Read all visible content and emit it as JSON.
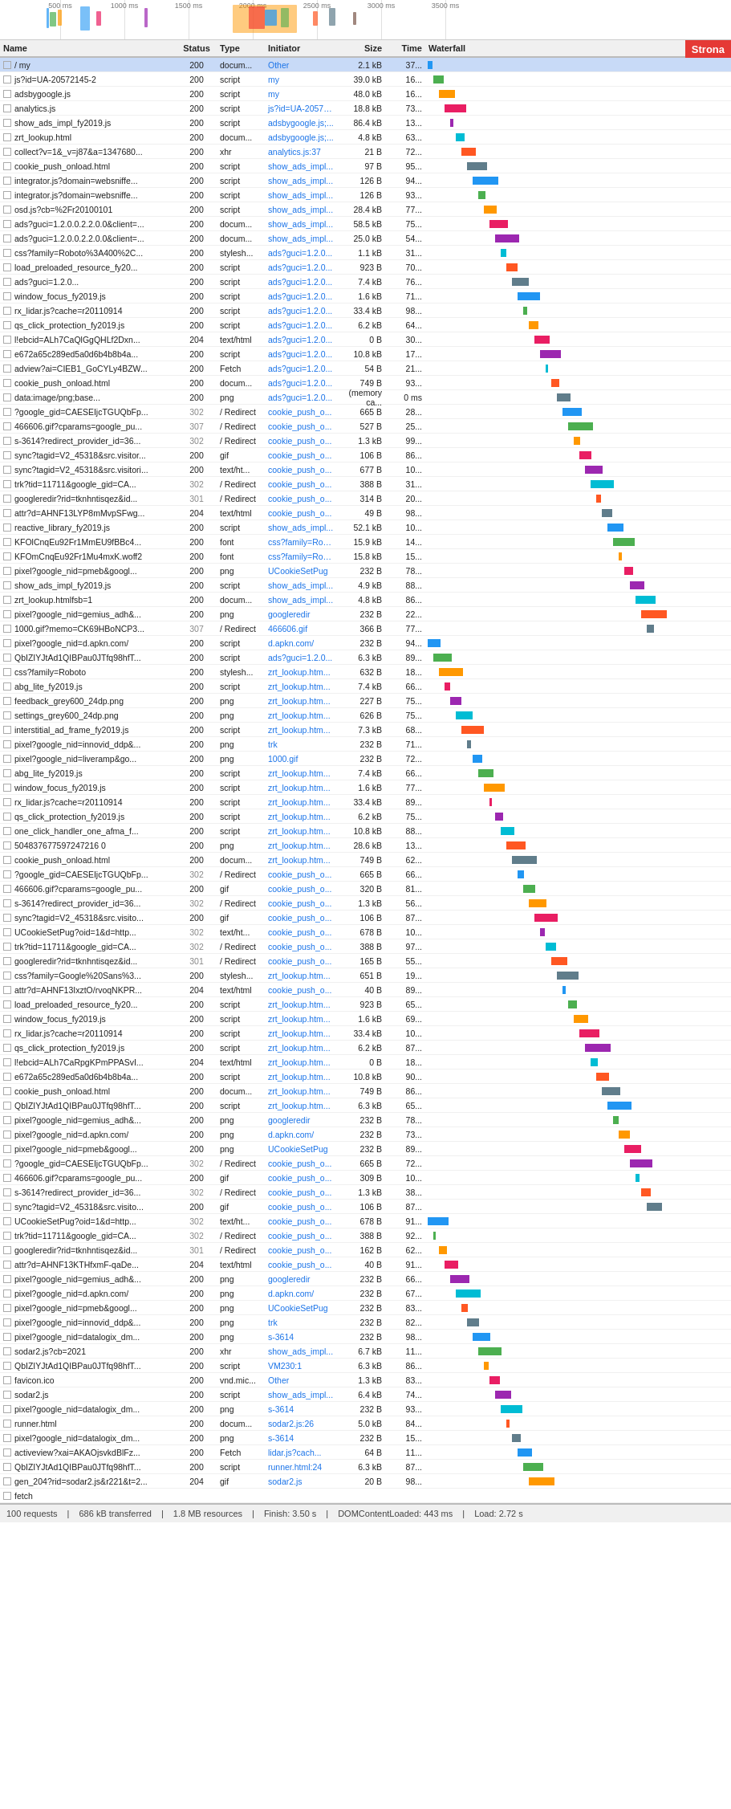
{
  "header": {
    "columns": [
      "Name",
      "Status",
      "Type",
      "Initiator",
      "Size",
      "Time",
      "Waterfall"
    ],
    "strona_badge": "Strona"
  },
  "timeline": {
    "ticks": [
      "500 ms",
      "1000 ms",
      "1500 ms",
      "2000 ms",
      "2500 ms",
      "3000 ms",
      "3500 ms"
    ]
  },
  "rows": [
    {
      "name": "/ my",
      "status": "200",
      "type": "docum...",
      "initiator": "Other",
      "size": "2.1 kB",
      "time": "37...",
      "selected": true
    },
    {
      "name": "js?id=UA-20572145-2",
      "status": "200",
      "type": "script",
      "initiator": "my",
      "size": "39.0 kB",
      "time": "16..."
    },
    {
      "name": "adsbygoogle.js",
      "status": "200",
      "type": "script",
      "initiator": "my",
      "size": "48.0 kB",
      "time": "16..."
    },
    {
      "name": "analytics.js",
      "status": "200",
      "type": "script",
      "initiator": "js?id=UA-20572...",
      "size": "18.8 kB",
      "time": "73..."
    },
    {
      "name": "show_ads_impl_fy2019.js",
      "status": "200",
      "type": "script",
      "initiator": "adsbygoogle.js;...",
      "size": "86.4 kB",
      "time": "13..."
    },
    {
      "name": "zrt_lookup.html",
      "status": "200",
      "type": "docum...",
      "initiator": "adsbygoogle.js;...",
      "size": "4.8 kB",
      "time": "63..."
    },
    {
      "name": "collect?v=1&_v=j87&a=1347680...",
      "status": "200",
      "type": "xhr",
      "initiator": "analytics.js:37",
      "size": "21 B",
      "time": "72..."
    },
    {
      "name": "cookie_push_onload.html",
      "status": "200",
      "type": "script",
      "initiator": "show_ads_impl...",
      "size": "97 B",
      "time": "95..."
    },
    {
      "name": "integrator.js?domain=websniffe...",
      "status": "200",
      "type": "script",
      "initiator": "show_ads_impl...",
      "size": "126 B",
      "time": "94..."
    },
    {
      "name": "integrator.js?domain=websniffe...",
      "status": "200",
      "type": "script",
      "initiator": "show_ads_impl...",
      "size": "126 B",
      "time": "93..."
    },
    {
      "name": "osd.js?cb=%2Fr20100101",
      "status": "200",
      "type": "script",
      "initiator": "show_ads_impl...",
      "size": "28.4 kB",
      "time": "77..."
    },
    {
      "name": "ads?guci=1.2.0.0.2.2.0.0&client=...",
      "status": "200",
      "type": "docum...",
      "initiator": "show_ads_impl...",
      "size": "58.5 kB",
      "time": "75..."
    },
    {
      "name": "ads?guci=1.2.0.0.2.2.0.0&client=...",
      "status": "200",
      "type": "docum...",
      "initiator": "show_ads_impl...",
      "size": "25.0 kB",
      "time": "54..."
    },
    {
      "name": "css?family=Roboto%3A400%2C...",
      "status": "200",
      "type": "stylesh...",
      "initiator": "ads?guci=1.2.0...",
      "size": "1.1 kB",
      "time": "31..."
    },
    {
      "name": "load_preloaded_resource_fy20...",
      "status": "200",
      "type": "script",
      "initiator": "ads?guci=1.2.0...",
      "size": "923 B",
      "time": "70..."
    },
    {
      "name": "ads?guci=1.2.0...",
      "status": "200",
      "type": "script",
      "initiator": "ads?guci=1.2.0...",
      "size": "7.4 kB",
      "time": "76..."
    },
    {
      "name": "window_focus_fy2019.js",
      "status": "200",
      "type": "script",
      "initiator": "ads?guci=1.2.0...",
      "size": "1.6 kB",
      "time": "71..."
    },
    {
      "name": "rx_lidar.js?cache=r20110914",
      "status": "200",
      "type": "script",
      "initiator": "ads?guci=1.2.0...",
      "size": "33.4 kB",
      "time": "98..."
    },
    {
      "name": "qs_click_protection_fy2019.js",
      "status": "200",
      "type": "script",
      "initiator": "ads?guci=1.2.0...",
      "size": "6.2 kB",
      "time": "64..."
    },
    {
      "name": "l!ebcid=ALh7CaQlGgQHLf2Dxn...",
      "status": "204",
      "type": "text/html",
      "initiator": "ads?guci=1.2.0...",
      "size": "0 B",
      "time": "30..."
    },
    {
      "name": "e672a65c289ed5a0d6b4b8b4a...",
      "status": "200",
      "type": "script",
      "initiator": "ads?guci=1.2.0...",
      "size": "10.8 kB",
      "time": "17..."
    },
    {
      "name": "adview?ai=CIEB1_GoCYLy4BZW...",
      "status": "200",
      "type": "Fetch",
      "initiator": "ads?guci=1.2.0...",
      "size": "54 B",
      "time": "21..."
    },
    {
      "name": "cookie_push_onload.html",
      "status": "200",
      "type": "docum...",
      "initiator": "ads?guci=1.2.0...",
      "size": "749 B",
      "time": "93..."
    },
    {
      "name": "data:image/png;base...",
      "status": "200",
      "type": "png",
      "initiator": "ads?guci=1.2.0...",
      "size": "(memory ca...",
      "time": "0 ms"
    },
    {
      "name": "?google_gid=CAESEIjcTGUQbFp...",
      "status": "302",
      "type": "/ Redirect",
      "initiator": "cookie_push_o...",
      "size": "665 B",
      "time": "28..."
    },
    {
      "name": "466606.gif?cparams=google_pu...",
      "status": "307",
      "type": "/ Redirect",
      "initiator": "cookie_push_o...",
      "size": "527 B",
      "time": "25..."
    },
    {
      "name": "s-3614?redirect_provider_id=36...",
      "status": "302",
      "type": "/ Redirect",
      "initiator": "cookie_push_o...",
      "size": "1.3 kB",
      "time": "99..."
    },
    {
      "name": "sync?tagid=V2_45318&src.visitor...",
      "status": "200",
      "type": "gif",
      "initiator": "cookie_push_o...",
      "size": "106 B",
      "time": "86..."
    },
    {
      "name": "sync?tagid=V2_45318&src.visitori...",
      "status": "200",
      "type": "text/ht...",
      "initiator": "cookie_push_o...",
      "size": "677 B",
      "time": "10..."
    },
    {
      "name": "trk?tid=11711&google_gid=CA...",
      "status": "302",
      "type": "/ Redirect",
      "initiator": "cookie_push_o...",
      "size": "388 B",
      "time": "31..."
    },
    {
      "name": "googleredir?rid=tknhntisqez&id...",
      "status": "301",
      "type": "/ Redirect",
      "initiator": "cookie_push_o...",
      "size": "314 B",
      "time": "20..."
    },
    {
      "name": "attr?d=AHNF13LYP8mMvpSFwg...",
      "status": "204",
      "type": "text/html",
      "initiator": "cookie_push_o...",
      "size": "49 B",
      "time": "98..."
    },
    {
      "name": "reactive_library_fy2019.js",
      "status": "200",
      "type": "script",
      "initiator": "show_ads_impl...",
      "size": "52.1 kB",
      "time": "10..."
    },
    {
      "name": "KFOlCnqEu92Fr1MmEU9fBBc4...",
      "status": "200",
      "type": "font",
      "initiator": "css?family=Rob...",
      "size": "15.9 kB",
      "time": "14..."
    },
    {
      "name": "KFOmCnqEu92Fr1Mu4mxK.woff2",
      "status": "200",
      "type": "font",
      "initiator": "css?family=Rob...",
      "size": "15.8 kB",
      "time": "15..."
    },
    {
      "name": "pixel?google_nid=pmeb&googl...",
      "status": "200",
      "type": "png",
      "initiator": "UCookieSetPug",
      "size": "232 B",
      "time": "78..."
    },
    {
      "name": "show_ads_impl_fy2019.js",
      "status": "200",
      "type": "script",
      "initiator": "show_ads_impl...",
      "size": "4.9 kB",
      "time": "88..."
    },
    {
      "name": "zrt_lookup.htmlfsb=1",
      "status": "200",
      "type": "docum...",
      "initiator": "show_ads_impl...",
      "size": "4.8 kB",
      "time": "86..."
    },
    {
      "name": "pixel?google_nid=gemius_adh&...",
      "status": "200",
      "type": "png",
      "initiator": "googleredir",
      "size": "232 B",
      "time": "22..."
    },
    {
      "name": "1000.gif?memo=CK69HBoNCP3...",
      "status": "307",
      "type": "/ Redirect",
      "initiator": "466606.gif",
      "size": "366 B",
      "time": "77..."
    },
    {
      "name": "pixel?google_nid=d.apkn.com/",
      "status": "200",
      "type": "script",
      "initiator": "d.apkn.com/",
      "size": "232 B",
      "time": "94..."
    },
    {
      "name": "QbIZIYJtAd1QIBPau0JTfq98hfT...",
      "status": "200",
      "type": "script",
      "initiator": "ads?guci=1.2.0...",
      "size": "6.3 kB",
      "time": "89..."
    },
    {
      "name": "css?family=Roboto",
      "status": "200",
      "type": "stylesh...",
      "initiator": "zrt_lookup.htm...",
      "size": "632 B",
      "time": "18..."
    },
    {
      "name": "abg_lite_fy2019.js",
      "status": "200",
      "type": "script",
      "initiator": "zrt_lookup.htm...",
      "size": "7.4 kB",
      "time": "66..."
    },
    {
      "name": "feedback_grey600_24dp.png",
      "status": "200",
      "type": "png",
      "initiator": "zrt_lookup.htm...",
      "size": "227 B",
      "time": "75..."
    },
    {
      "name": "settings_grey600_24dp.png",
      "status": "200",
      "type": "png",
      "initiator": "zrt_lookup.htm...",
      "size": "626 B",
      "time": "75..."
    },
    {
      "name": "interstitial_ad_frame_fy2019.js",
      "status": "200",
      "type": "script",
      "initiator": "zrt_lookup.htm...",
      "size": "7.3 kB",
      "time": "68..."
    },
    {
      "name": "pixel?google_nid=innovid_ddp&...",
      "status": "200",
      "type": "png",
      "initiator": "trk",
      "size": "232 B",
      "time": "71..."
    },
    {
      "name": "pixel?google_nid=liveramp&go...",
      "status": "200",
      "type": "png",
      "initiator": "1000.gif",
      "size": "232 B",
      "time": "72..."
    },
    {
      "name": "abg_lite_fy2019.js",
      "status": "200",
      "type": "script",
      "initiator": "zrt_lookup.htm...",
      "size": "7.4 kB",
      "time": "66..."
    },
    {
      "name": "window_focus_fy2019.js",
      "status": "200",
      "type": "script",
      "initiator": "zrt_lookup.htm...",
      "size": "1.6 kB",
      "time": "77..."
    },
    {
      "name": "rx_lidar.js?cache=r20110914",
      "status": "200",
      "type": "script",
      "initiator": "zrt_lookup.htm...",
      "size": "33.4 kB",
      "time": "89..."
    },
    {
      "name": "qs_click_protection_fy2019.js",
      "status": "200",
      "type": "script",
      "initiator": "zrt_lookup.htm...",
      "size": "6.2 kB",
      "time": "75..."
    },
    {
      "name": "one_click_handler_one_afma_f...",
      "status": "200",
      "type": "script",
      "initiator": "zrt_lookup.htm...",
      "size": "10.8 kB",
      "time": "88..."
    },
    {
      "name": "504837677597247216 0",
      "status": "200",
      "type": "png",
      "initiator": "zrt_lookup.htm...",
      "size": "28.6 kB",
      "time": "13..."
    },
    {
      "name": "cookie_push_onload.html",
      "status": "200",
      "type": "docum...",
      "initiator": "zrt_lookup.htm...",
      "size": "749 B",
      "time": "62..."
    },
    {
      "name": "?google_gid=CAESEIjcTGUQbFp...",
      "status": "302",
      "type": "/ Redirect",
      "initiator": "cookie_push_o...",
      "size": "665 B",
      "time": "66..."
    },
    {
      "name": "466606.gif?cparams=google_pu...",
      "status": "200",
      "type": "gif",
      "initiator": "cookie_push_o...",
      "size": "320 B",
      "time": "81..."
    },
    {
      "name": "s-3614?redirect_provider_id=36...",
      "status": "302",
      "type": "/ Redirect",
      "initiator": "cookie_push_o...",
      "size": "1.3 kB",
      "time": "56..."
    },
    {
      "name": "sync?tagid=V2_45318&src.visito...",
      "status": "200",
      "type": "gif",
      "initiator": "cookie_push_o...",
      "size": "106 B",
      "time": "87..."
    },
    {
      "name": "UCookieSetPug?oid=1&d=http...",
      "status": "302",
      "type": "text/ht...",
      "initiator": "cookie_push_o...",
      "size": "678 B",
      "time": "10..."
    },
    {
      "name": "trk?tid=11711&google_gid=CA...",
      "status": "302",
      "type": "/ Redirect",
      "initiator": "cookie_push_o...",
      "size": "388 B",
      "time": "97..."
    },
    {
      "name": "googleredir?rid=tknhntisqez&id...",
      "status": "301",
      "type": "/ Redirect",
      "initiator": "cookie_push_o...",
      "size": "165 B",
      "time": "55..."
    },
    {
      "name": "css?family=Google%20Sans%3...",
      "status": "200",
      "type": "stylesh...",
      "initiator": "zrt_lookup.htm...",
      "size": "651 B",
      "time": "19..."
    },
    {
      "name": "attr?d=AHNF13IxztO/rvoqNKPR...",
      "status": "204",
      "type": "text/html",
      "initiator": "cookie_push_o...",
      "size": "40 B",
      "time": "89..."
    },
    {
      "name": "load_preloaded_resource_fy20...",
      "status": "200",
      "type": "script",
      "initiator": "zrt_lookup.htm...",
      "size": "923 B",
      "time": "65..."
    },
    {
      "name": "window_focus_fy2019.js",
      "status": "200",
      "type": "script",
      "initiator": "zrt_lookup.htm...",
      "size": "1.6 kB",
      "time": "69..."
    },
    {
      "name": "rx_lidar.js?cache=r20110914",
      "status": "200",
      "type": "script",
      "initiator": "zrt_lookup.htm...",
      "size": "33.4 kB",
      "time": "10..."
    },
    {
      "name": "qs_click_protection_fy2019.js",
      "status": "200",
      "type": "script",
      "initiator": "zrt_lookup.htm...",
      "size": "6.2 kB",
      "time": "87..."
    },
    {
      "name": "l!ebcid=ALh7CaRpgKPmPPASvI...",
      "status": "204",
      "type": "text/html",
      "initiator": "zrt_lookup.htm...",
      "size": "0 B",
      "time": "18..."
    },
    {
      "name": "e672a65c289ed5a0d6b4b8b4a...",
      "status": "200",
      "type": "script",
      "initiator": "zrt_lookup.htm...",
      "size": "10.8 kB",
      "time": "90..."
    },
    {
      "name": "cookie_push_onload.html",
      "status": "200",
      "type": "docum...",
      "initiator": "zrt_lookup.htm...",
      "size": "749 B",
      "time": "86..."
    },
    {
      "name": "QbIZIYJtAd1QIBPau0JTfq98hfT...",
      "status": "200",
      "type": "script",
      "initiator": "zrt_lookup.htm...",
      "size": "6.3 kB",
      "time": "65..."
    },
    {
      "name": "pixel?google_nid=gemius_adh&...",
      "status": "200",
      "type": "png",
      "initiator": "googleredir",
      "size": "232 B",
      "time": "78..."
    },
    {
      "name": "pixel?google_nid=d.apkn.com/",
      "status": "200",
      "type": "png",
      "initiator": "d.apkn.com/",
      "size": "232 B",
      "time": "73..."
    },
    {
      "name": "pixel?google_nid=pmeb&googl...",
      "status": "200",
      "type": "png",
      "initiator": "UCookieSetPug",
      "size": "232 B",
      "time": "89..."
    },
    {
      "name": "?google_gid=CAESEIjcTGUQbFp...",
      "status": "302",
      "type": "/ Redirect",
      "initiator": "cookie_push_o...",
      "size": "665 B",
      "time": "72..."
    },
    {
      "name": "466606.gif?cparams=google_pu...",
      "status": "200",
      "type": "gif",
      "initiator": "cookie_push_o...",
      "size": "309 B",
      "time": "10..."
    },
    {
      "name": "s-3614?redirect_provider_id=36...",
      "status": "302",
      "type": "/ Redirect",
      "initiator": "cookie_push_o...",
      "size": "1.3 kB",
      "time": "38..."
    },
    {
      "name": "sync?tagid=V2_45318&src.visito...",
      "status": "200",
      "type": "gif",
      "initiator": "cookie_push_o...",
      "size": "106 B",
      "time": "87..."
    },
    {
      "name": "UCookieSetPug?oid=1&d=http...",
      "status": "302",
      "type": "text/ht...",
      "initiator": "cookie_push_o...",
      "size": "678 B",
      "time": "91..."
    },
    {
      "name": "trk?tid=11711&google_gid=CA...",
      "status": "302",
      "type": "/ Redirect",
      "initiator": "cookie_push_o...",
      "size": "388 B",
      "time": "92..."
    },
    {
      "name": "googleredir?rid=tknhntisqez&id...",
      "status": "301",
      "type": "/ Redirect",
      "initiator": "cookie_push_o...",
      "size": "162 B",
      "time": "62..."
    },
    {
      "name": "attr?d=AHNF13KTHfxmF-qaDe...",
      "status": "204",
      "type": "text/html",
      "initiator": "cookie_push_o...",
      "size": "40 B",
      "time": "91..."
    },
    {
      "name": "pixel?google_nid=gemius_adh&...",
      "status": "200",
      "type": "png",
      "initiator": "googleredir",
      "size": "232 B",
      "time": "66..."
    },
    {
      "name": "pixel?google_nid=d.apkn.com/",
      "status": "200",
      "type": "png",
      "initiator": "d.apkn.com/",
      "size": "232 B",
      "time": "67..."
    },
    {
      "name": "pixel?google_nid=pmeb&googl...",
      "status": "200",
      "type": "png",
      "initiator": "UCookieSetPug",
      "size": "232 B",
      "time": "83..."
    },
    {
      "name": "pixel?google_nid=innovid_ddp&...",
      "status": "200",
      "type": "png",
      "initiator": "trk",
      "size": "232 B",
      "time": "82..."
    },
    {
      "name": "pixel?google_nid=datalogix_dm...",
      "status": "200",
      "type": "png",
      "initiator": "s-3614",
      "size": "232 B",
      "time": "98..."
    },
    {
      "name": "sodar2.js?cb=2021",
      "status": "200",
      "type": "xhr",
      "initiator": "show_ads_impl...",
      "size": "6.7 kB",
      "time": "11..."
    },
    {
      "name": "QbIZIYJtAd1QIBPau0JTfq98hfT...",
      "status": "200",
      "type": "script",
      "initiator": "VM230:1",
      "size": "6.3 kB",
      "time": "86..."
    },
    {
      "name": "favicon.ico",
      "status": "200",
      "type": "vnd.mic...",
      "initiator": "Other",
      "size": "1.3 kB",
      "time": "83..."
    },
    {
      "name": "sodar2.js",
      "status": "200",
      "type": "script",
      "initiator": "show_ads_impl...",
      "size": "6.4 kB",
      "time": "74..."
    },
    {
      "name": "pixel?google_nid=datalogix_dm...",
      "status": "200",
      "type": "png",
      "initiator": "s-3614",
      "size": "232 B",
      "time": "93..."
    },
    {
      "name": "runner.html",
      "status": "200",
      "type": "docum...",
      "initiator": "sodar2.js:26",
      "size": "5.0 kB",
      "time": "84..."
    },
    {
      "name": "pixel?google_nid=datalogix_dm...",
      "status": "200",
      "type": "png",
      "initiator": "s-3614",
      "size": "232 B",
      "time": "15..."
    },
    {
      "name": "activeview?xai=AKAOjsvkdBlFz...",
      "status": "200",
      "type": "Fetch",
      "initiator": "lidar.js?cach...",
      "size": "64 B",
      "time": "11..."
    },
    {
      "name": "QbIZIYJtAd1QIBPau0JTfq98hfT...",
      "status": "200",
      "type": "script",
      "initiator": "runner.html:24",
      "size": "6.3 kB",
      "time": "87..."
    },
    {
      "name": "gen_204?rid=sodar2.js&r221&t=2...",
      "status": "204",
      "type": "gif",
      "initiator": "sodar2.js",
      "size": "20 B",
      "time": "98..."
    },
    {
      "name": "fetch",
      "status": "",
      "type": "",
      "initiator": "",
      "size": "",
      "time": ""
    }
  ],
  "footer": {
    "requests": "100 requests",
    "transferred": "686 kB transferred",
    "resources": "1.8 MB resources",
    "finish": "Finish: 3.50 s",
    "dom_content_loaded": "DOMContentLoaded: 443 ms",
    "load": "Load: 2.72 s"
  }
}
